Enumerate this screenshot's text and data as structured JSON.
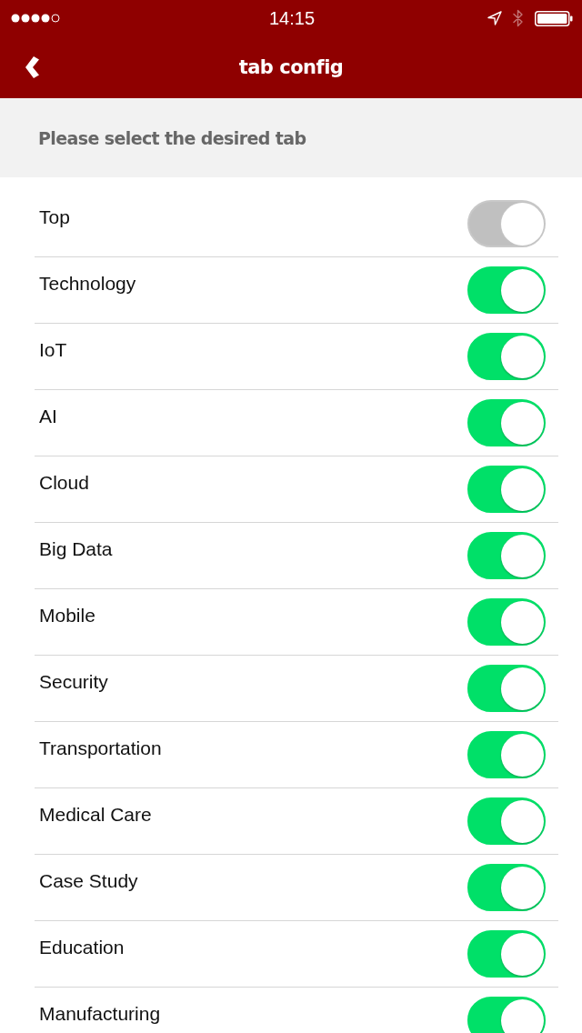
{
  "status_bar": {
    "time": "14:15"
  },
  "nav_bar": {
    "title": "tab config"
  },
  "section_header": {
    "text": "Please select the desired tab"
  },
  "tabs": [
    {
      "label": "Top",
      "on": true,
      "disabled": true
    },
    {
      "label": "Technology",
      "on": true,
      "disabled": false
    },
    {
      "label": "IoT",
      "on": true,
      "disabled": false
    },
    {
      "label": "AI",
      "on": true,
      "disabled": false
    },
    {
      "label": "Cloud",
      "on": true,
      "disabled": false
    },
    {
      "label": "Big Data",
      "on": true,
      "disabled": false
    },
    {
      "label": "Mobile",
      "on": true,
      "disabled": false
    },
    {
      "label": "Security",
      "on": true,
      "disabled": false
    },
    {
      "label": "Transportation",
      "on": true,
      "disabled": false
    },
    {
      "label": "Medical Care",
      "on": true,
      "disabled": false
    },
    {
      "label": "Case Study",
      "on": true,
      "disabled": false
    },
    {
      "label": "Education",
      "on": true,
      "disabled": false
    },
    {
      "label": "Manufacturing",
      "on": true,
      "disabled": false
    }
  ]
}
